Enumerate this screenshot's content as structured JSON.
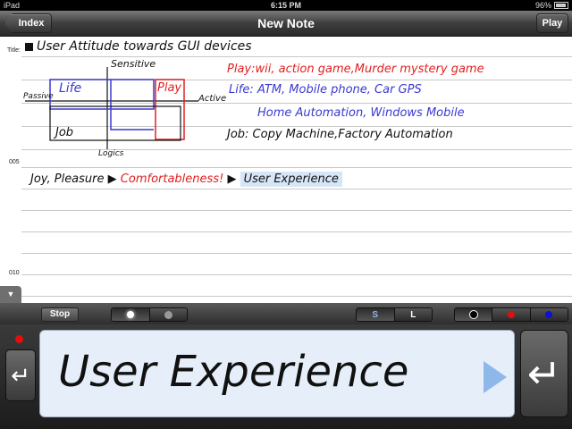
{
  "status": {
    "carrier": "iPad",
    "time": "6:15 PM",
    "battery": "96%"
  },
  "nav": {
    "back_label": "Index",
    "title": "New Note",
    "play_label": "Play"
  },
  "note": {
    "title_label": "Title:",
    "title_text": "User Attitude towards GUI devices",
    "line_005": "005",
    "line_010": "010",
    "diagram": {
      "sensitive": "Sensitive",
      "passive": "Passive",
      "active": "Active",
      "logics": "Logics",
      "life": "Life",
      "play": "Play",
      "job": "Job"
    },
    "lines": {
      "play_line": "Play:wii, action game,Murder mystery game",
      "life_line": "Life: ATM, Mobile phone, Car GPS",
      "life_line2": "Home Automation, Windows Mobile",
      "job_line": "Job: Copy Machine,Factory Automation",
      "joy_a": "Joy, Pleasure",
      "joy_b": "Comfortableness",
      "joy_c": "User Experience"
    },
    "colors": {
      "blue": "#3a3ad0",
      "red": "#e02020",
      "highlight": "#d6e6f7"
    }
  },
  "toolbar": {
    "stop_label": "Stop",
    "size_small": "S",
    "size_large": "L",
    "pen_colors": [
      "#000000",
      "#e01010",
      "#1010d0"
    ]
  },
  "input": {
    "text": "User Experience"
  },
  "icons": {
    "return": "return-arrow-icon",
    "enter": "enter-arrow-icon",
    "play": "play-triangle-icon"
  }
}
